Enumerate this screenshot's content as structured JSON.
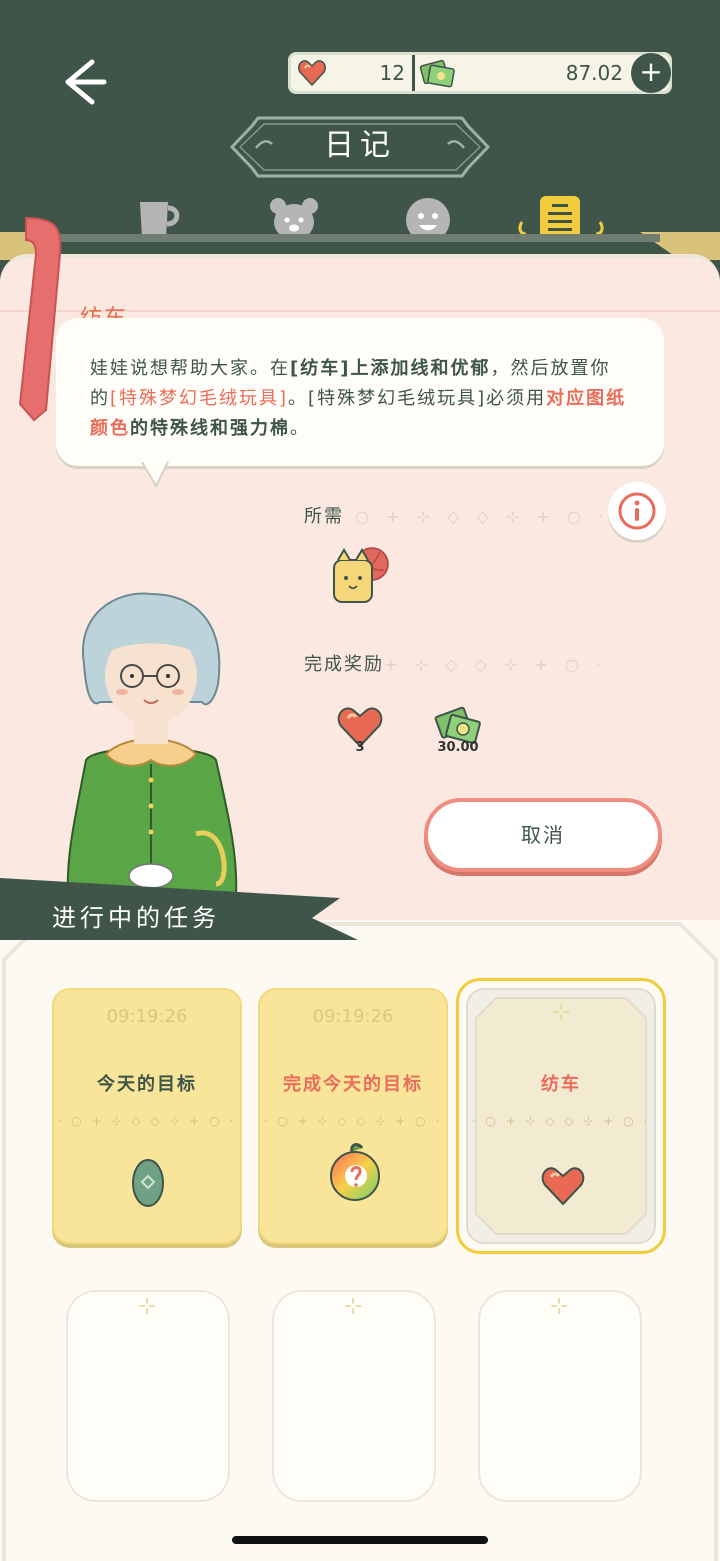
{
  "header": {
    "title": "日记",
    "hearts": "12",
    "money": "87.02",
    "plus": "+"
  },
  "tabs": [
    {
      "name": "cup",
      "active": false
    },
    {
      "name": "bear",
      "active": false
    },
    {
      "name": "face",
      "active": false
    },
    {
      "name": "diary",
      "active": true
    }
  ],
  "task": {
    "title": "纺车",
    "desc_parts": {
      "p1": "娃娃说想帮助大家。在",
      "p2": "[纺车]上添加线和优郁",
      "p3": "，然后放置你的",
      "p4": "[特殊梦幻毛绒玩具]",
      "p5": "。[特殊梦幻毛绒玩具]必须用",
      "p6": "对应图纸颜色",
      "p7": "的特殊线和强力棉",
      "p8": "。"
    },
    "required_label": "所需",
    "reward_label": "完成奖励",
    "reward_hearts": "3",
    "reward_money": "30.00",
    "cancel_label": "取消"
  },
  "ongoing": {
    "title": "进行中的任务",
    "cards": [
      {
        "timer": "09:19:26",
        "name": "今天的目标",
        "dots": "· ○ + ⊹ ◇ ◇ ⊹ + ○ ·"
      },
      {
        "timer": "09:19:26",
        "name": "完成今天的目标",
        "dots": "· ○ + ⊹ ◇ ◇ ⊹ + ○ ·"
      },
      {
        "timer": "",
        "name": "纺车",
        "dots": "· ○ + ⊹ ◇ ◇ ⊹ + ○ ·"
      }
    ]
  },
  "colors": {
    "dark_green": "#3f554a",
    "card_yellow": "#f9e59a",
    "accent_red": "#ea6c5a",
    "page_pink": "#fbe8e1"
  }
}
